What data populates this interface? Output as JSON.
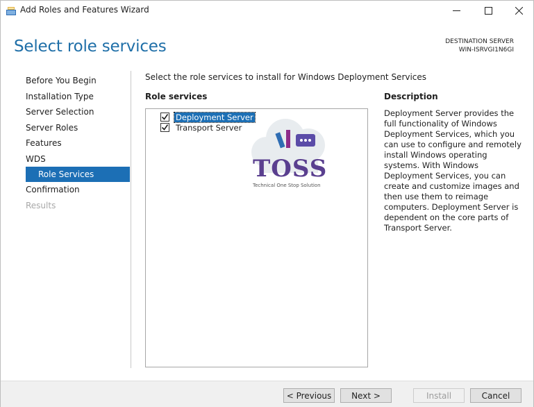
{
  "window": {
    "title": "Add Roles and Features Wizard"
  },
  "header": {
    "page_title": "Select role services",
    "destination_label": "DESTINATION SERVER",
    "destination_server": "WIN-ISRVGI1N6GI"
  },
  "nav": {
    "items": [
      {
        "label": "Before You Begin",
        "state": "normal"
      },
      {
        "label": "Installation Type",
        "state": "normal"
      },
      {
        "label": "Server Selection",
        "state": "normal"
      },
      {
        "label": "Server Roles",
        "state": "normal"
      },
      {
        "label": "Features",
        "state": "normal"
      },
      {
        "label": "WDS",
        "state": "normal"
      },
      {
        "label": "Role Services",
        "state": "active"
      },
      {
        "label": "Confirmation",
        "state": "normal"
      },
      {
        "label": "Results",
        "state": "disabled"
      }
    ]
  },
  "main": {
    "instruction": "Select the role services to install for Windows Deployment Services",
    "role_services_label": "Role services",
    "role_services": [
      {
        "label": "Deployment Server",
        "checked": true,
        "selected": true
      },
      {
        "label": "Transport Server",
        "checked": true,
        "selected": false
      }
    ],
    "description_label": "Description",
    "description": "Deployment Server provides the full functionality of Windows Deployment Services, which you can use to configure and remotely install Windows operating systems. With Windows Deployment Services, you can create and customize images and then use them to reimage computers. Deployment Server is dependent on the core parts of Transport Server."
  },
  "watermark": {
    "logo_text": "TOSS",
    "tagline": "Technical One Stop Solution"
  },
  "footer": {
    "previous_label": "< Previous",
    "next_label": "Next >",
    "install_label": "Install",
    "cancel_label": "Cancel"
  },
  "colors": {
    "accent": "#1c6fb5",
    "title": "#1f6fa8"
  }
}
